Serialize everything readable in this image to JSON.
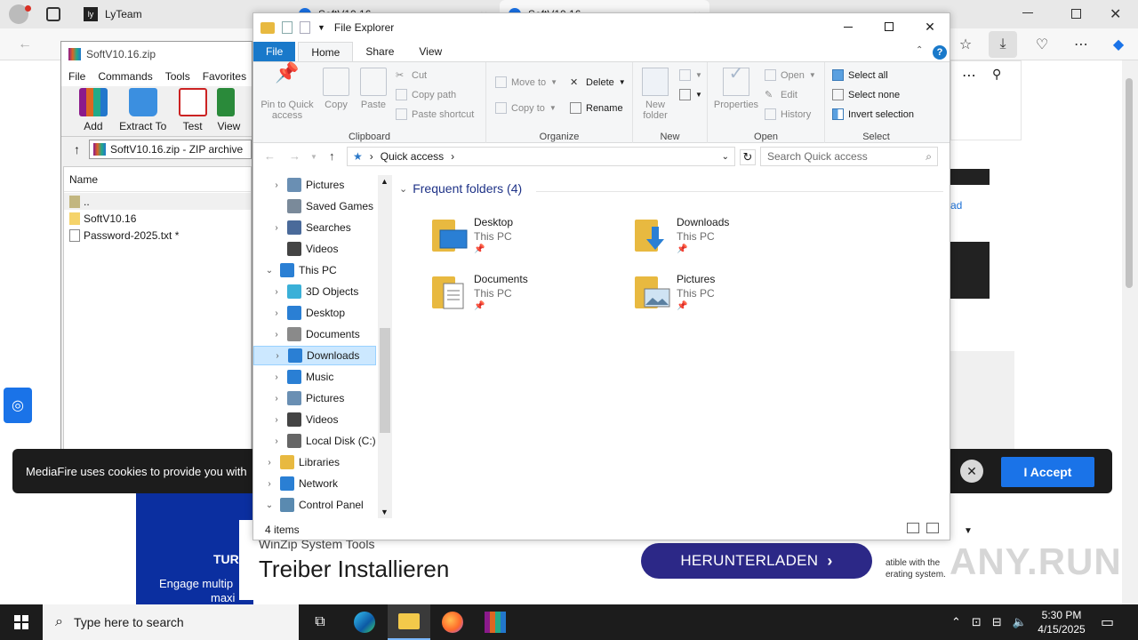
{
  "browser": {
    "tabs": [
      {
        "label": "LyTeam",
        "close": "×"
      },
      {
        "label": "SoftV10.16",
        "close": "×"
      },
      {
        "label": "SoftV10.16",
        "close": "×"
      }
    ],
    "dark_card_text": "ad"
  },
  "winrar": {
    "title": "SoftV10.16.zip",
    "menu": [
      "File",
      "Commands",
      "Tools",
      "Favorites"
    ],
    "tools": [
      "Add",
      "Extract To",
      "Test",
      "View"
    ],
    "path": "SoftV10.16.zip - ZIP archive",
    "column_name": "Name",
    "rows": [
      "..",
      "SoftV10.16",
      "Password-2025.txt *"
    ]
  },
  "cookie": {
    "text": "MediaFire uses cookies to provide you with",
    "accept": "I Accept"
  },
  "blue_ad": {
    "line1": "TUR",
    "line2": "Engage multip",
    "line3": "maxi"
  },
  "ad": {
    "subtitle": "WinZip System Tools",
    "headline": "Treiber Installieren",
    "button": "HERUNTERLADEN",
    "right_text_1": "atible with the",
    "right_text_2": "erating system."
  },
  "watermark": "ANY.RUN",
  "explorer": {
    "title": "File Explorer",
    "tabs": [
      "File",
      "Home",
      "Share",
      "View"
    ],
    "ribbon": {
      "clipboard": {
        "label": "Clipboard",
        "pin": "Pin to Quick access",
        "copy": "Copy",
        "paste": "Paste",
        "cut": "Cut",
        "copy_path": "Copy path",
        "paste_shortcut": "Paste shortcut"
      },
      "organize": {
        "label": "Organize",
        "move_to": "Move to",
        "copy_to": "Copy to",
        "delete": "Delete",
        "rename": "Rename"
      },
      "new": {
        "label": "New",
        "new_folder": "New folder"
      },
      "open": {
        "label": "Open",
        "properties": "Properties",
        "open": "Open",
        "edit": "Edit",
        "history": "History"
      },
      "select": {
        "label": "Select",
        "select_all": "Select all",
        "select_none": "Select none",
        "invert": "Invert selection"
      }
    },
    "address": "Quick access",
    "search_placeholder": "Search Quick access",
    "nav": [
      {
        "label": "Pictures",
        "icon": "pictures-icon",
        "indent": 1,
        "chev": "›"
      },
      {
        "label": "Saved Games",
        "icon": "saved-games-icon",
        "indent": 1,
        "chev": ""
      },
      {
        "label": "Searches",
        "icon": "searches-icon",
        "indent": 1,
        "chev": "›"
      },
      {
        "label": "Videos",
        "icon": "videos-icon",
        "indent": 1,
        "chev": ""
      },
      {
        "label": "This PC",
        "icon": "this-pc-icon",
        "indent": 0,
        "chev": "⌄"
      },
      {
        "label": "3D Objects",
        "icon": "3d-objects-icon",
        "indent": 1,
        "chev": "›"
      },
      {
        "label": "Desktop",
        "icon": "desktop-icon",
        "indent": 1,
        "chev": "›"
      },
      {
        "label": "Documents",
        "icon": "documents-icon",
        "indent": 1,
        "chev": "›"
      },
      {
        "label": "Downloads",
        "icon": "downloads-icon",
        "indent": 1,
        "chev": "›",
        "selected": true
      },
      {
        "label": "Music",
        "icon": "music-icon",
        "indent": 1,
        "chev": "›"
      },
      {
        "label": "Pictures",
        "icon": "pictures-icon",
        "indent": 1,
        "chev": "›"
      },
      {
        "label": "Videos",
        "icon": "videos-icon",
        "indent": 1,
        "chev": "›"
      },
      {
        "label": "Local Disk (C:)",
        "icon": "local-disk-icon",
        "indent": 1,
        "chev": "›"
      },
      {
        "label": "Libraries",
        "icon": "libraries-icon",
        "indent": 0,
        "chev": "›"
      },
      {
        "label": "Network",
        "icon": "network-icon",
        "indent": 0,
        "chev": "›"
      },
      {
        "label": "Control Panel",
        "icon": "control-panel-icon",
        "indent": 0,
        "chev": "⌄"
      }
    ],
    "section_title": "Frequent folders (4)",
    "folders": [
      {
        "name": "Desktop",
        "location": "This PC",
        "icon": "desktop-folder-icon"
      },
      {
        "name": "Downloads",
        "location": "This PC",
        "icon": "downloads-folder-icon"
      },
      {
        "name": "Documents",
        "location": "This PC",
        "icon": "documents-folder-icon"
      },
      {
        "name": "Pictures",
        "location": "This PC",
        "icon": "pictures-folder-icon"
      }
    ],
    "status": "4 items"
  },
  "taskbar": {
    "search_placeholder": "Type here to search",
    "time": "5:30 PM",
    "date": "4/15/2025"
  },
  "colors": {
    "accent": "#1979ca",
    "selection": "#cce8ff",
    "cookie_accept": "#1a73e8",
    "ad_button": "#2c2887"
  }
}
